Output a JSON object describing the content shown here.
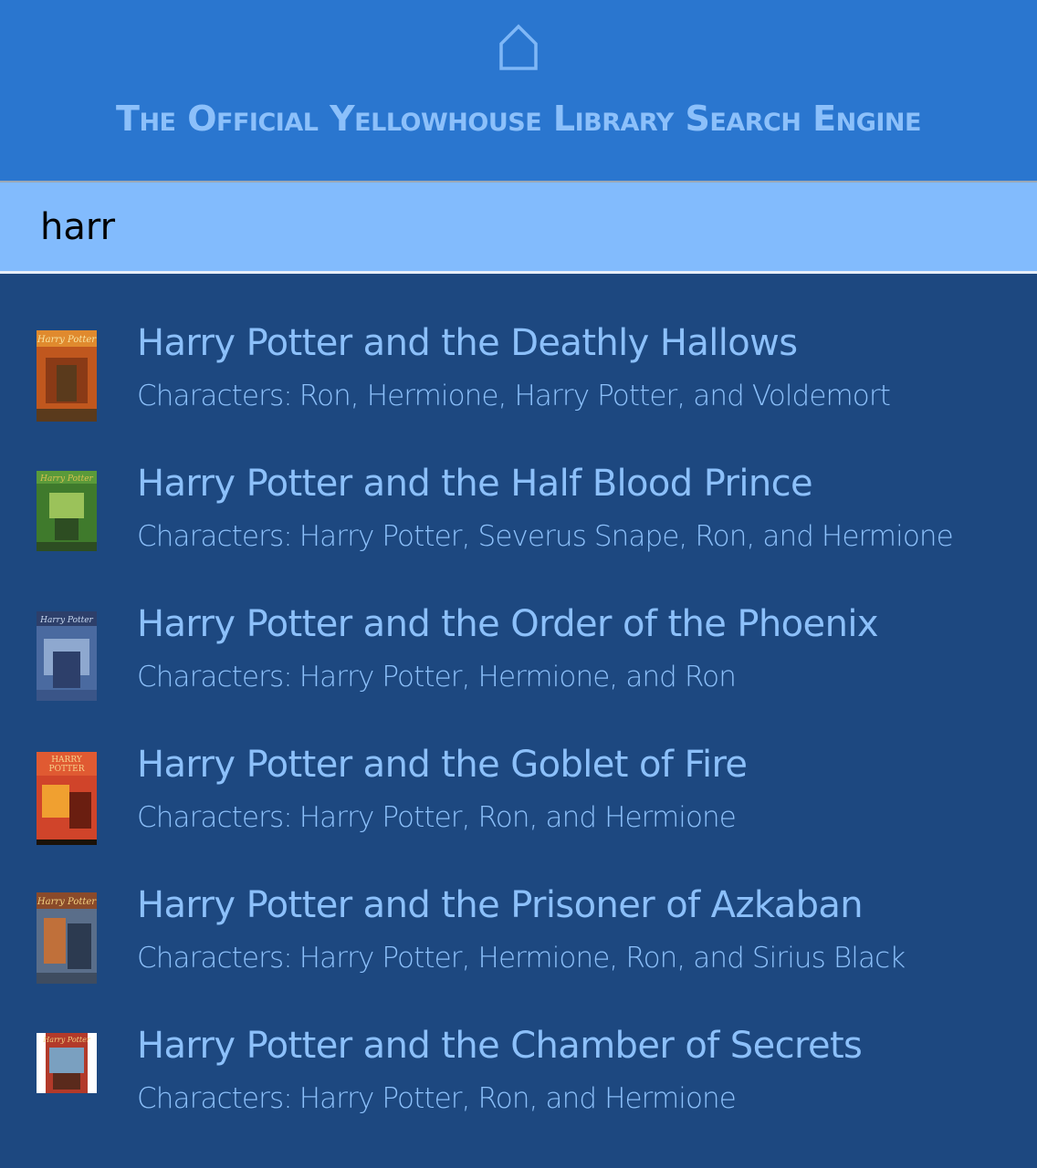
{
  "header": {
    "home_icon": "home-icon",
    "title": "The Official Yellowhouse Library Search Engine"
  },
  "search": {
    "value": "harr",
    "placeholder": ""
  },
  "results": [
    {
      "title": "Harry Potter and the Deathly Hallows",
      "characters_label": "Characters:",
      "characters": "Ron, Hermione, Harry Potter, and Voldemort",
      "cover_colors": [
        "#c0571e",
        "#e08a2e",
        "#5a3a1c"
      ]
    },
    {
      "title": "Harry Potter and the Half Blood Prince",
      "characters_label": "Characters:",
      "characters": "Harry Potter, Severus Snape, Ron, and Hermione",
      "cover_colors": [
        "#3f7a2c",
        "#9bc25a",
        "#2d4d22"
      ]
    },
    {
      "title": "Harry Potter and the Order of the Phoenix",
      "characters_label": "Characters:",
      "characters": "Harry Potter, Hermione, and Ron",
      "cover_colors": [
        "#4a6aa0",
        "#8ea8cf",
        "#2d3f6a"
      ]
    },
    {
      "title": "Harry Potter and the Goblet of Fire",
      "characters_label": "Characters:",
      "characters": "Harry Potter, Ron, and Hermione",
      "cover_colors": [
        "#d0442a",
        "#f0a030",
        "#6a1e10"
      ]
    },
    {
      "title": "Harry Potter and the Prisoner of Azkaban",
      "characters_label": "Characters:",
      "characters": "Harry Potter, Hermione, Ron, and Sirius Black",
      "cover_colors": [
        "#5a6e8a",
        "#c0703a",
        "#2c3a50"
      ]
    },
    {
      "title": "Harry Potter and the Chamber of Secrets",
      "characters_label": "Characters:",
      "characters": "Harry Potter, Ron, and Hermione",
      "cover_colors": [
        "#b23a2a",
        "#7aa0c0",
        "#ffffff"
      ]
    }
  ],
  "colors": {
    "header_bg": "#2a76cf",
    "search_bg": "#82bbfd",
    "page_bg": "#1d4880",
    "text_accent": "#8cc0fa"
  }
}
